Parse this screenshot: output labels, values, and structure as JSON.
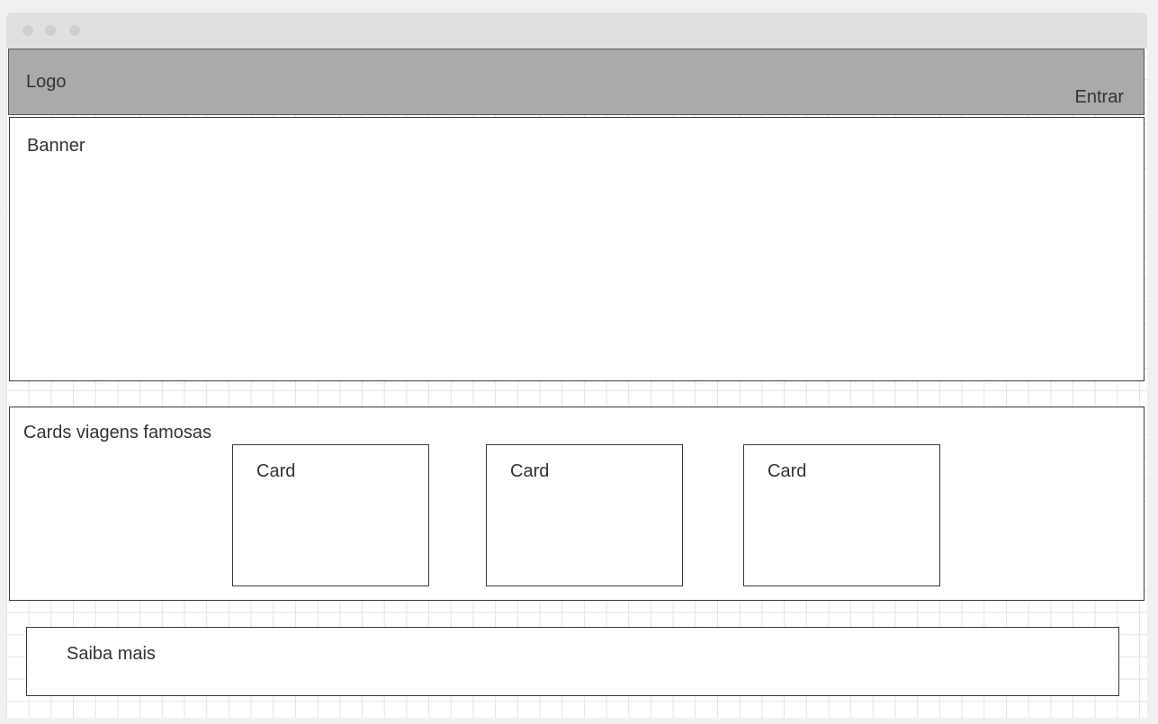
{
  "header": {
    "logo": "Logo",
    "login_label": "Entrar"
  },
  "banner": {
    "label": "Banner"
  },
  "cards_section": {
    "label": "Cards viagens famosas",
    "cards": [
      {
        "label": "Card"
      },
      {
        "label": "Card"
      },
      {
        "label": "Card"
      }
    ]
  },
  "saiba_mais": {
    "label": "Saiba mais"
  }
}
